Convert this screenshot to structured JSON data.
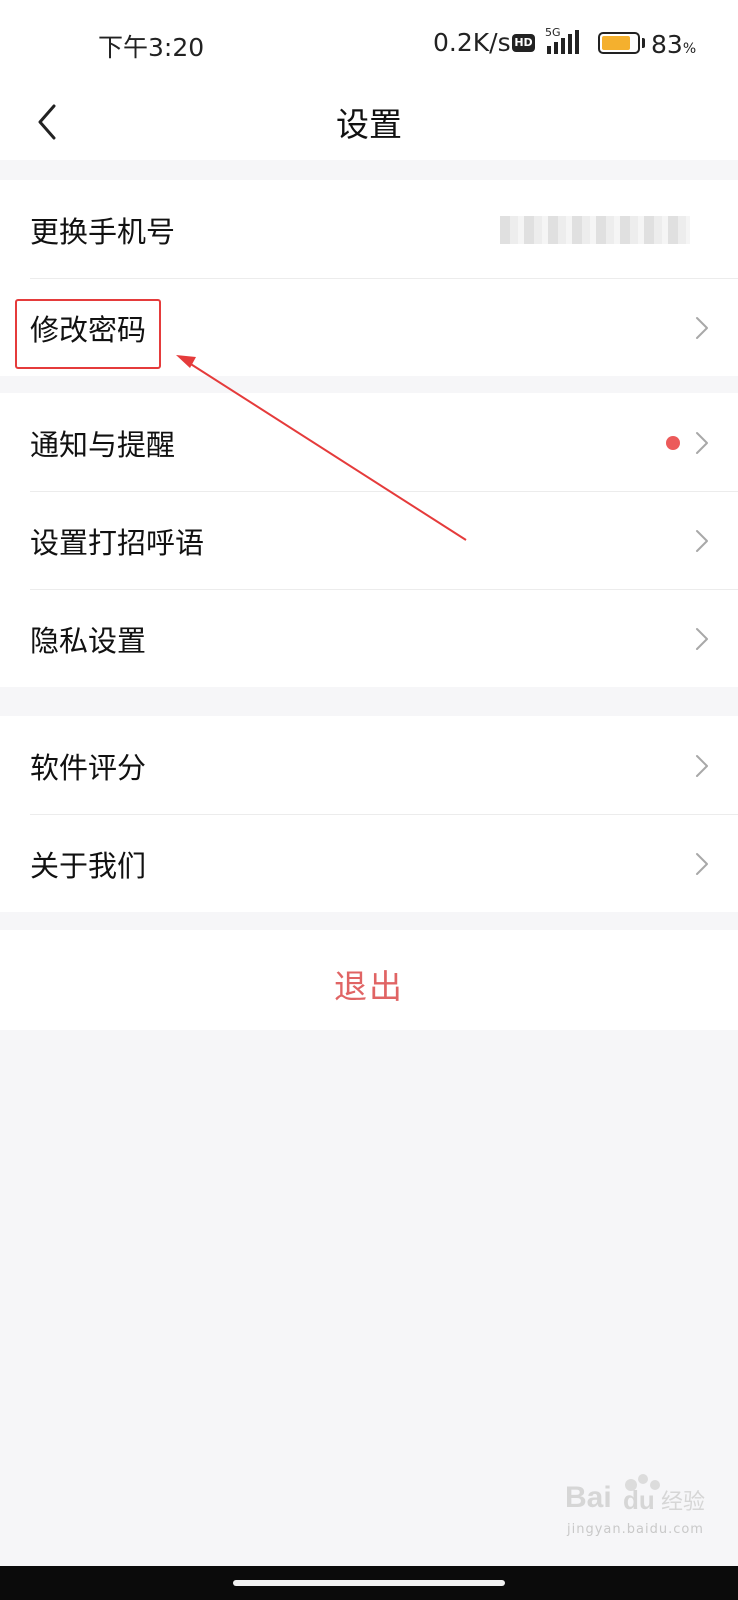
{
  "status_bar": {
    "time": "下午3:20",
    "network_speed": "0.2K/s",
    "hd_badge": "HD",
    "network_type": "5G",
    "battery_percent": "83",
    "battery_percent_sign": "%",
    "battery_level": 0.83
  },
  "header": {
    "title": "设置",
    "back_icon": "chevron-left-icon"
  },
  "groups": [
    {
      "items": [
        {
          "label": "更换手机号",
          "value_masked": true
        },
        {
          "label": "修改密码",
          "chevron": true,
          "highlighted": true
        }
      ]
    },
    {
      "items": [
        {
          "label": "通知与提醒",
          "chevron": true,
          "badge": "red-dot"
        },
        {
          "label": "设置打招呼语",
          "chevron": true
        },
        {
          "label": "隐私设置",
          "chevron": true
        }
      ]
    },
    {
      "items": [
        {
          "label": "软件评分",
          "chevron": true
        },
        {
          "label": "关于我们",
          "chevron": true
        }
      ]
    }
  ],
  "logout": {
    "label": "退出"
  },
  "colors": {
    "accent_red": "#e06464",
    "badge_red": "#ec5a5a",
    "annotation_red": "#e53b3b",
    "background": "#f6f6f8",
    "battery": "#f4b02e"
  },
  "watermark": {
    "brand": "Bai du 经验",
    "url": "jingyan.baidu.com"
  }
}
